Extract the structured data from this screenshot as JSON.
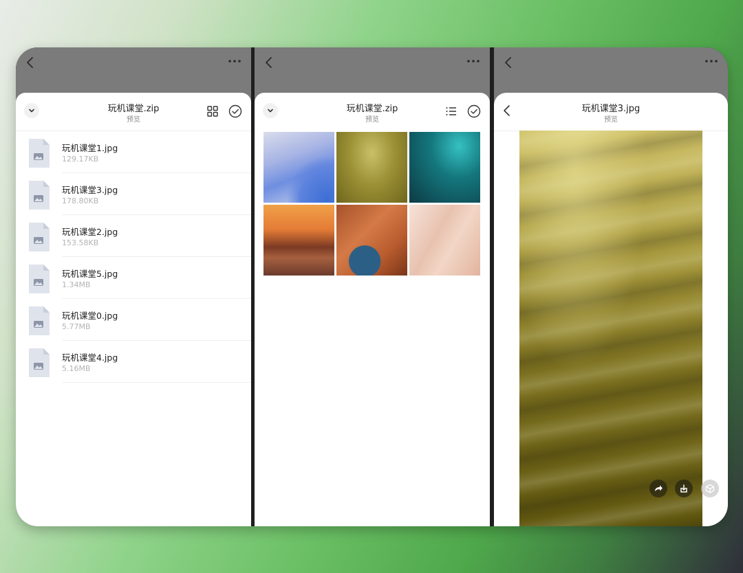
{
  "panels": [
    {
      "title": "玩机课堂.zip",
      "subtitle": "预览",
      "files": [
        {
          "name": "玩机课堂1.jpg",
          "size": "129.17KB"
        },
        {
          "name": "玩机课堂3.jpg",
          "size": "178.80KB"
        },
        {
          "name": "玩机课堂2.jpg",
          "size": "153.58KB"
        },
        {
          "name": "玩机课堂5.jpg",
          "size": "1.34MB"
        },
        {
          "name": "玩机课堂0.jpg",
          "size": "5.77MB"
        },
        {
          "name": "玩机课堂4.jpg",
          "size": "5.16MB"
        }
      ]
    },
    {
      "title": "玩机课堂.zip",
      "subtitle": "预览"
    },
    {
      "title": "玩机课堂3.jpg",
      "subtitle": "预览"
    }
  ],
  "icons": {
    "back": "chevron-left-icon",
    "more": "more-horizontal-icon",
    "collapse": "chevron-down-icon",
    "grid_view": "grid-icon",
    "list_view": "list-icon",
    "select": "check-circle-icon",
    "file": "image-file-icon",
    "share": "share-icon",
    "save": "download-icon",
    "open": "cube-icon"
  },
  "colors": {
    "topbar": "#7b7b7b",
    "sheet": "#ffffff",
    "text_primary": "#222222",
    "text_secondary": "#b3b3b3"
  }
}
